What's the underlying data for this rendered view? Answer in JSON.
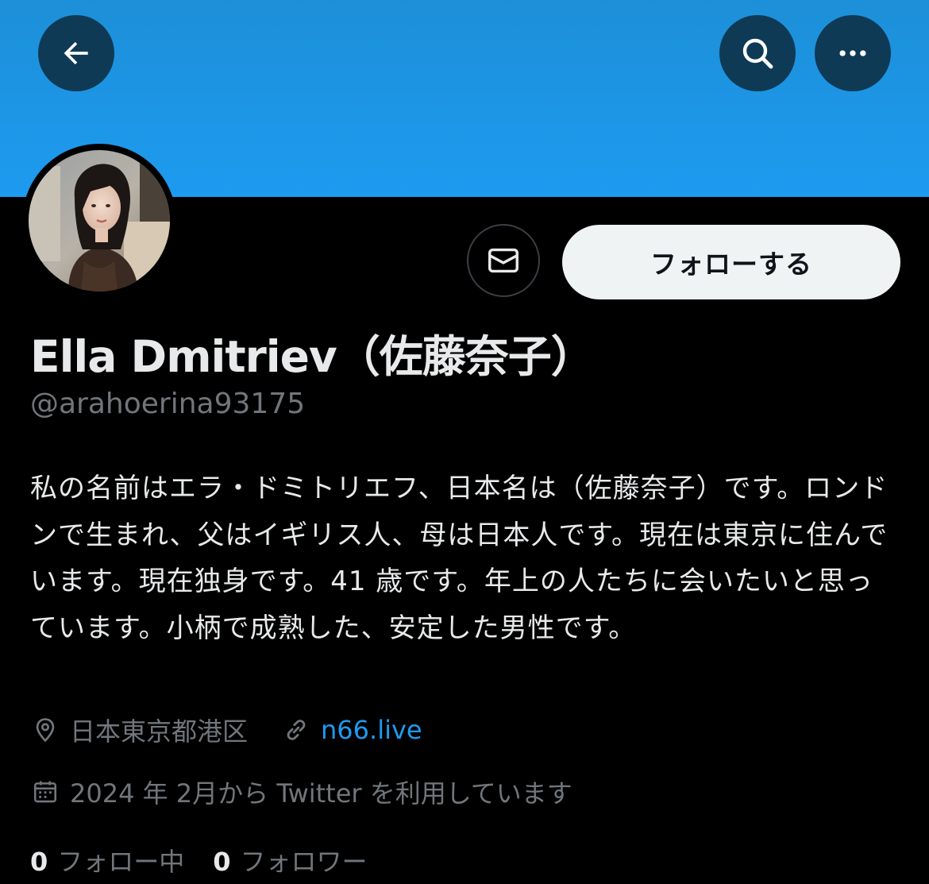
{
  "profile": {
    "display_name": "Ella Dmitriev（佐藤奈子）",
    "handle": "@arahoerina93175",
    "bio": "私の名前はエラ・ドミトリエフ、日本名は（佐藤奈子）です。ロンドンで生まれ、父はイギリス人、母は日本人です。現在は東京に住んでいます。現在独身です。41 歳です。年上の人たちに会いたいと思っています。小柄で成熟した、安定した男性です。",
    "location": "日本東京都港区",
    "website": "n66.live",
    "joined": "2024 年 2月から Twitter を利用しています"
  },
  "actions": {
    "follow_label": "フォローする"
  },
  "stats": {
    "following_count": "0",
    "following_label": "フォロー中",
    "followers_count": "0",
    "followers_label": "フォロワー"
  },
  "icons": {
    "back": "arrow-left-icon",
    "search": "search-icon",
    "more": "more-horizontal-icon",
    "message": "envelope-icon",
    "location": "location-pin-icon",
    "link": "link-icon",
    "calendar": "calendar-icon"
  },
  "colors": {
    "banner": "#1d9bf0",
    "header_button": "#0f3a55",
    "link": "#1d9bf0",
    "muted_text": "#71767b",
    "primary_text": "#e7e9ea",
    "follow_button_bg": "#eff3f4"
  }
}
